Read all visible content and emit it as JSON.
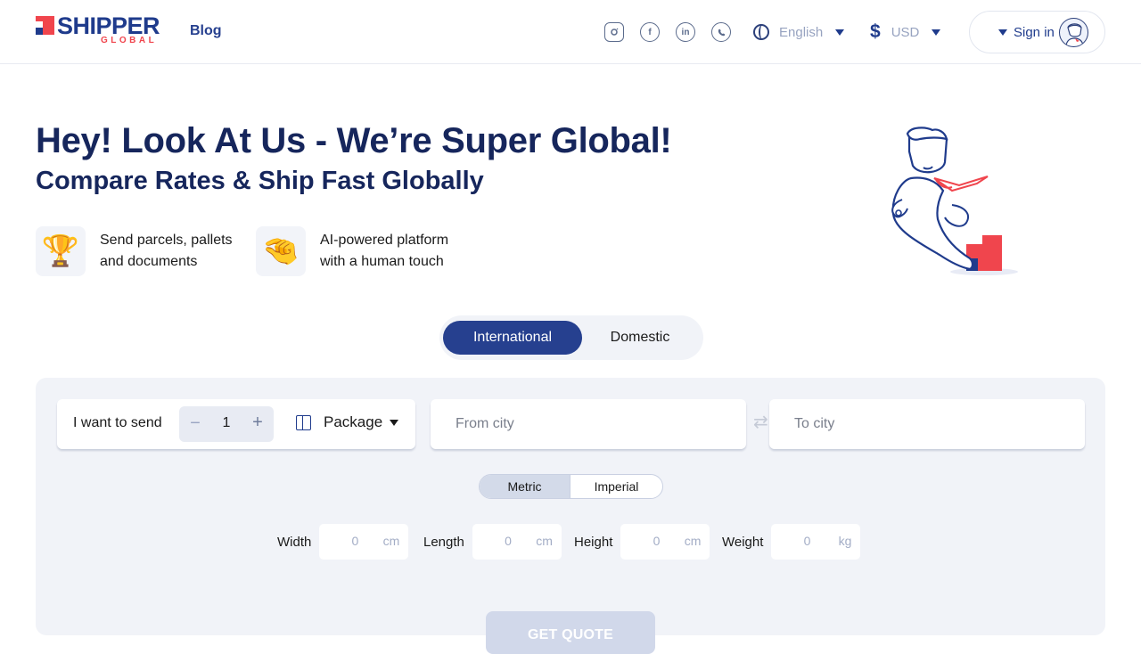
{
  "header": {
    "brand_name": "SHIPPER",
    "brand_sub": "GLOBAL",
    "blog_label": "Blog",
    "social_icons": [
      "instagram-icon",
      "facebook-icon",
      "linkedin-icon",
      "whatsapp-icon"
    ],
    "language": "English",
    "currency_symbol": "$",
    "currency": "USD",
    "signin_label": "Sign in"
  },
  "hero": {
    "title": "Hey! Look At Us - We’re Super Global!",
    "subtitle": "Compare Rates & Ship Fast Globally",
    "features": [
      {
        "icon": "trophy-icon",
        "glyph": "🏆",
        "text": "Send parcels, pallets and documents"
      },
      {
        "icon": "pinch-hand-icon",
        "glyph": "🤏",
        "text": "AI-powered platform with a human touch"
      }
    ]
  },
  "tabs": {
    "international": "International",
    "domestic": "Domestic",
    "active": "International"
  },
  "form": {
    "send_label": "I want to send",
    "quantity": "1",
    "minus": "−",
    "plus": "+",
    "package_type": "Package",
    "from_placeholder": "From city",
    "to_placeholder": "To city",
    "units": {
      "metric": "Metric",
      "imperial": "Imperial",
      "selected": "Metric"
    },
    "dimensions": [
      {
        "label": "Width",
        "value": "0",
        "unit": "cm"
      },
      {
        "label": "Length",
        "value": "0",
        "unit": "cm"
      },
      {
        "label": "Height",
        "value": "0",
        "unit": "cm"
      },
      {
        "label": "Weight",
        "value": "0",
        "unit": "kg"
      }
    ],
    "quote_button": "GET QUOTE"
  },
  "colors": {
    "brand_blue": "#1f3b8c",
    "brand_red": "#f0454d",
    "tab_active": "#26408f",
    "panel_bg": "#f1f3f8"
  }
}
